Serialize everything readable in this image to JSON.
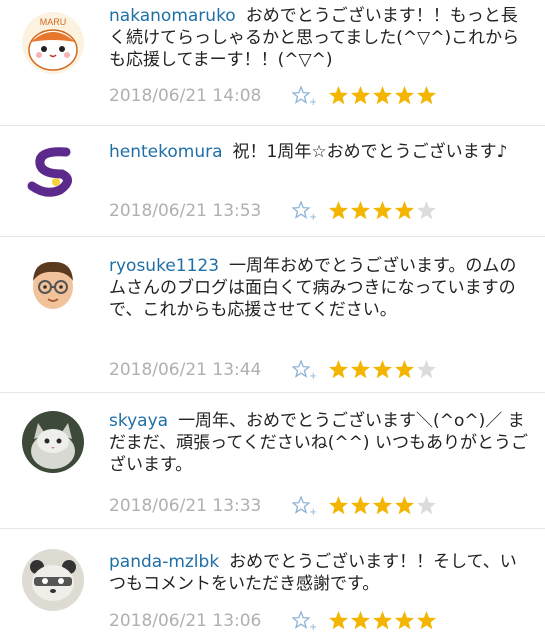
{
  "comments": [
    {
      "user": "nakanomaruko",
      "text": "おめでとうございます！！もっと長く続けてらっしゃるかと思ってました(^▽^)これからも応援してまーす！！(^▽^)",
      "date": "2018/06/21 14:08",
      "rating": 5,
      "avatar_icon": "hamster-maru-icon",
      "avatar_text": "MARU"
    },
    {
      "user": "hentekomura",
      "text": "祝！1周年☆おめでとうございます♪",
      "date": "2018/06/21 13:53",
      "rating": 4,
      "avatar_icon": "purple-s-logo-icon"
    },
    {
      "user": "ryosuke1123",
      "text": "一周年おめでとうございます。のムのムさんのブログは面白くて病みつきになっていますので、これからも応援させてください。",
      "date": "2018/06/21 13:44",
      "rating": 4,
      "avatar_icon": "glasses-man-icon"
    },
    {
      "user": "skyaya",
      "text": "一周年、おめでとうございます＼(^o^)／ まだまだ、頑張ってくださいね(^^) いつもありがとうございます。",
      "date": "2018/06/21 13:33",
      "rating": 4,
      "avatar_icon": "cat-photo-icon"
    },
    {
      "user": "panda-mzlbk",
      "text": "おめでとうございます！！そして、いつもコメントをいただき感謝です。",
      "date": "2018/06/21 13:06",
      "rating": 5,
      "avatar_icon": "panda-face-icon"
    }
  ],
  "colors": {
    "username": "#1f6fa7",
    "date": "#b0b0b0",
    "star_filled": "#f3b500",
    "star_empty": "#dcdcdc",
    "star_add": "#8fb4d9"
  }
}
